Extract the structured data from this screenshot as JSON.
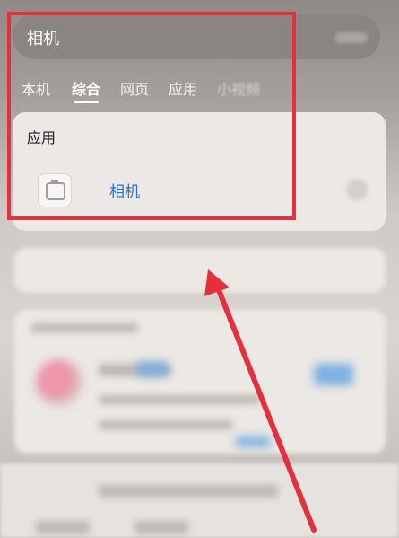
{
  "search": {
    "query": "相机"
  },
  "tabs": [
    {
      "label": "本机"
    },
    {
      "label": "综合"
    },
    {
      "label": "网页"
    },
    {
      "label": "应用"
    },
    {
      "label": "小视频"
    }
  ],
  "active_tab": "综合",
  "result_card": {
    "section_title": "应用",
    "app": {
      "name": "相机",
      "icon": "camera-icon"
    }
  },
  "colors": {
    "highlight": "#e2303c",
    "link_blue": "#2f6fc9"
  }
}
